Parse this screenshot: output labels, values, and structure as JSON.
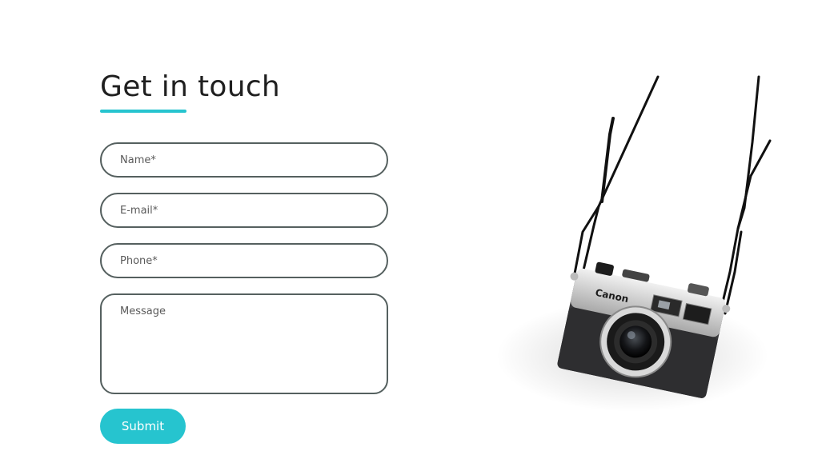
{
  "contact": {
    "title": "Get in touch",
    "fields": {
      "name_placeholder": "Name*",
      "email_placeholder": "E-mail*",
      "phone_placeholder": "Phone*",
      "message_placeholder": "Message"
    },
    "submit_label": "Submit"
  },
  "image": {
    "subject": "hanging film camera photo",
    "brand_text": "Canon"
  },
  "colors": {
    "accent": "#26c4cf",
    "field_border": "#55605f",
    "title": "#1f1f1f"
  }
}
